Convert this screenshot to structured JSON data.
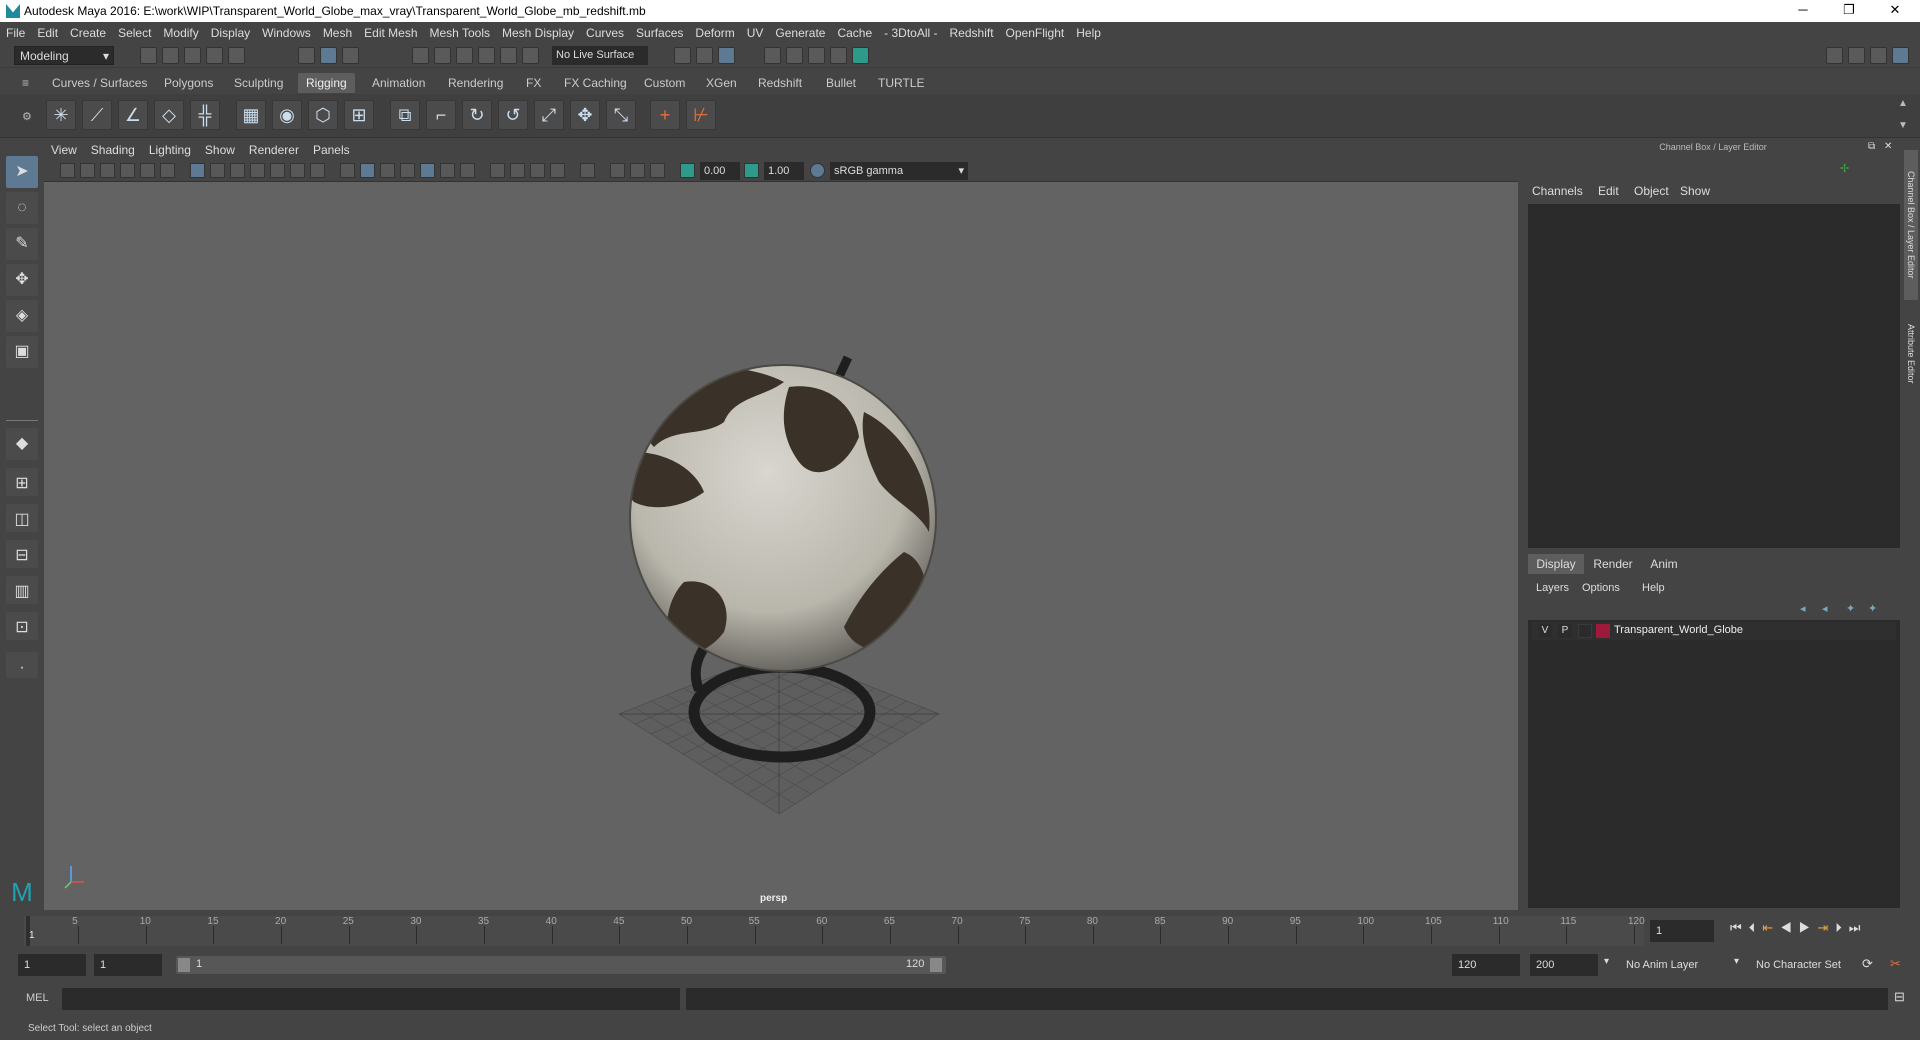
{
  "window": {
    "title": "Autodesk Maya 2016: E:\\work\\WIP\\Transparent_World_Globe_max_vray\\Transparent_World_Globe_mb_redshift.mb",
    "minimize": "─",
    "restore": "❐",
    "close": "✕"
  },
  "menubar": [
    "File",
    "Edit",
    "Create",
    "Select",
    "Modify",
    "Display",
    "Windows",
    "Mesh",
    "Edit Mesh",
    "Mesh Tools",
    "Mesh Display",
    "Curves",
    "Surfaces",
    "Deform",
    "UV",
    "Generate",
    "Cache",
    "- 3DtoAll -",
    "Redshift",
    "OpenFlight",
    "Help"
  ],
  "statusline": {
    "mode": "Modeling",
    "live_surface": "No Live Surface"
  },
  "shelf_tabs": [
    "Curves / Surfaces",
    "Polygons",
    "Sculpting",
    "Rigging",
    "Animation",
    "Rendering",
    "FX",
    "FX Caching",
    "Custom",
    "XGen",
    "Redshift",
    "Bullet",
    "TURTLE"
  ],
  "active_shelf_tab": "Rigging",
  "viewport": {
    "menu": [
      "View",
      "Shading",
      "Lighting",
      "Show",
      "Renderer",
      "Panels"
    ],
    "exposure": "0.00",
    "gamma": "1.00",
    "color_space": "sRGB gamma",
    "camera_label": "persp"
  },
  "channel_box": {
    "title": "Channel Box / Layer Editor",
    "menu": [
      "Channels",
      "Edit",
      "Object",
      "Show"
    ]
  },
  "layer_editor": {
    "tabs": [
      "Display",
      "Render",
      "Anim"
    ],
    "active_tab": "Display",
    "menu": [
      "Layers",
      "Options",
      "Help"
    ],
    "layers": [
      {
        "visible": "V",
        "playback": "P",
        "name": "Transparent_World_Globe",
        "color": "#9e1a3a"
      }
    ]
  },
  "side_tabs": [
    "Channel Box / Layer Editor",
    "Attribute Editor"
  ],
  "timeline": {
    "ticks": [
      "5",
      "10",
      "15",
      "20",
      "25",
      "30",
      "35",
      "40",
      "45",
      "50",
      "55",
      "60",
      "65",
      "70",
      "75",
      "80",
      "85",
      "90",
      "95",
      "100",
      "105",
      "110",
      "115",
      "120"
    ],
    "start_label": "1",
    "current_frame": "1"
  },
  "range": {
    "start": "1",
    "playback_start": "1",
    "slider_start": "1",
    "slider_end": "120",
    "playback_end": "120",
    "end": "200",
    "anim_layer": "No Anim Layer",
    "character_set": "No Character Set"
  },
  "command_line": {
    "label": "MEL"
  },
  "help_line": {
    "text": "Select Tool: select an object"
  }
}
